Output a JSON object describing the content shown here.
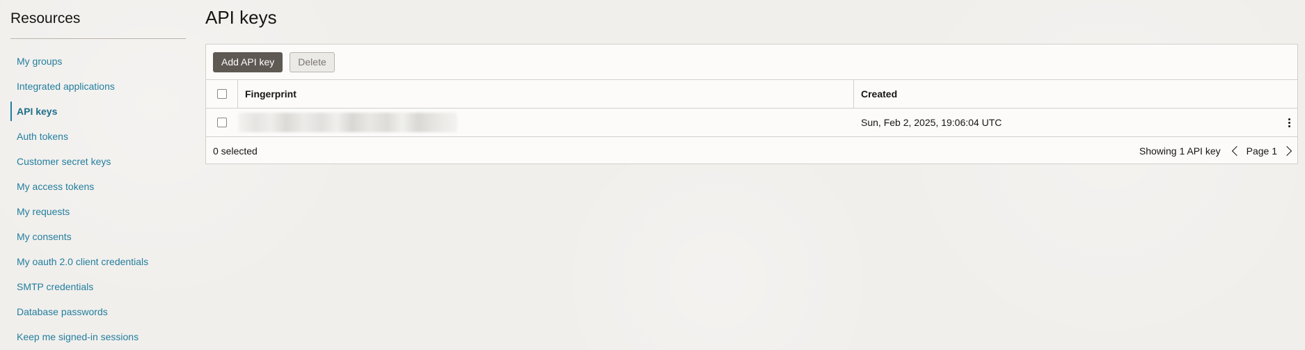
{
  "sidebar": {
    "title": "Resources",
    "items": [
      {
        "label": "My groups"
      },
      {
        "label": "Integrated applications"
      },
      {
        "label": "API keys",
        "active": true
      },
      {
        "label": "Auth tokens"
      },
      {
        "label": "Customer secret keys"
      },
      {
        "label": "My access tokens"
      },
      {
        "label": "My requests"
      },
      {
        "label": "My consents"
      },
      {
        "label": "My oauth 2.0 client credentials"
      },
      {
        "label": "SMTP credentials"
      },
      {
        "label": "Database passwords"
      },
      {
        "label": "Keep me signed-in sessions"
      }
    ]
  },
  "main": {
    "title": "API keys",
    "toolbar": {
      "add_label": "Add API key",
      "delete_label": "Delete"
    },
    "table": {
      "columns": [
        "Fingerprint",
        "Created"
      ],
      "rows": [
        {
          "fingerprint": "",
          "created": "Sun, Feb 2, 2025, 19:06:04 UTC"
        }
      ]
    },
    "footer": {
      "selected": "0 selected",
      "count": "Showing 1 API key",
      "page": "Page 1"
    }
  },
  "icons": {
    "prev": "chevron-left-icon",
    "next": "chevron-right-icon",
    "actions": "kebab-menu-icon"
  },
  "colors": {
    "link": "#227e9e",
    "primary_button": "#5f5954",
    "background": "#f1efec"
  }
}
